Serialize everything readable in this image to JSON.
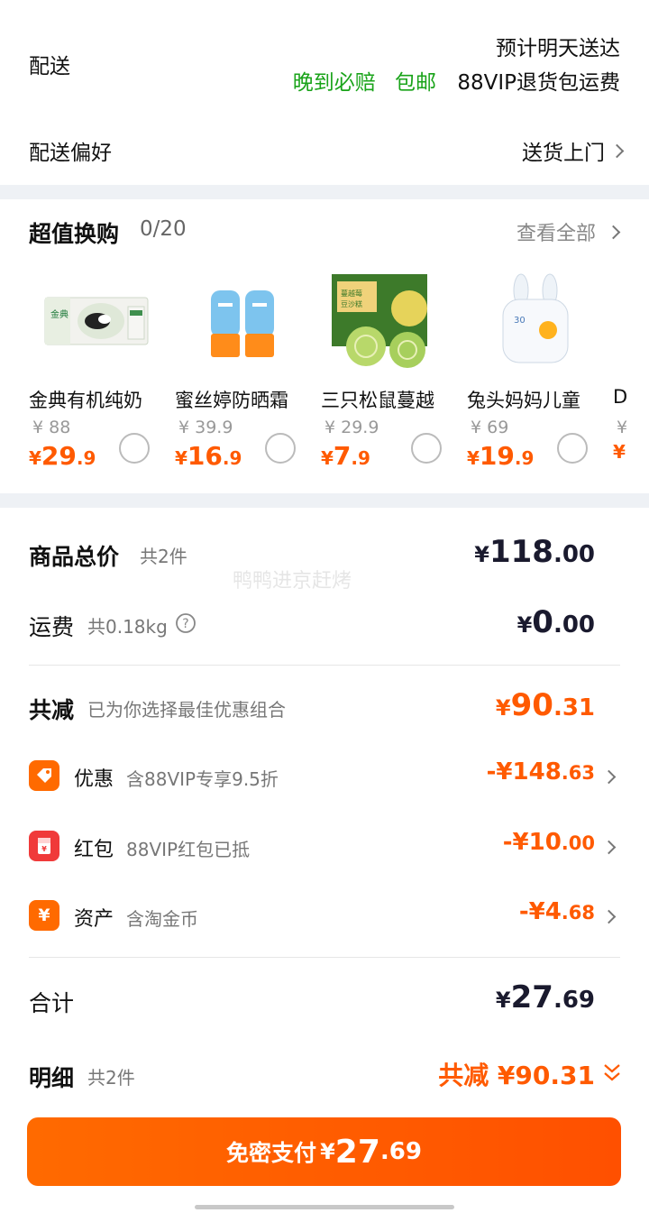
{
  "delivery": {
    "label": "配送",
    "eta": "预计明天送达",
    "tags": [
      "晚到必赔",
      "包邮",
      "88VIP退货包运费"
    ],
    "pref_label": "配送偏好",
    "pref_value": "送货上门"
  },
  "exchange": {
    "title": "超值换购",
    "count": "0/20",
    "view_all": "查看全部",
    "products": [
      {
        "name": "金典有机纯奶",
        "orig": "¥ 88",
        "price_int": "29",
        "price_dec": ".9"
      },
      {
        "name": "蜜丝婷防晒霜",
        "orig": "¥ 39.9",
        "price_int": "16",
        "price_dec": ".9"
      },
      {
        "name": "三只松鼠蔓越",
        "orig": "¥ 29.9",
        "price_int": "7",
        "price_dec": ".9"
      },
      {
        "name": "兔头妈妈儿童",
        "orig": "¥ 69",
        "price_int": "19",
        "price_dec": ".9"
      },
      {
        "name": "D",
        "orig": "¥",
        "price_int": "",
        "price_dec": ""
      }
    ],
    "currency": "¥"
  },
  "summary": {
    "goods_label": "商品总价",
    "goods_sub": "共2件",
    "goods_int": "118",
    "goods_dec": ".00",
    "freight_label": "运费",
    "freight_sub": "共0.18kg",
    "freight_int": "0",
    "freight_dec": ".00",
    "reduce_label": "共减",
    "reduce_sub": "已为你选择最佳优惠组合",
    "reduce_int": "90",
    "reduce_dec": ".31",
    "discounts": [
      {
        "label": "优惠",
        "sub": "含88VIP专享9.5折",
        "prefix": "-¥",
        "int": "148",
        "dec": ".63",
        "icon": "tag-icon",
        "color": "#ff6a00"
      },
      {
        "label": "红包",
        "sub": "88VIP红包已抵",
        "prefix": "-¥",
        "int": "10",
        "dec": ".00",
        "icon": "red-packet-icon",
        "color": "#f03a3a"
      },
      {
        "label": "资产",
        "sub": "含淘金币",
        "prefix": "-¥",
        "int": "4",
        "dec": ".68",
        "icon": "coin-icon",
        "color": "#ff6a00"
      }
    ],
    "total_label": "合计",
    "total_int": "27",
    "total_dec": ".69",
    "detail_label": "明细",
    "detail_sub": "共2件",
    "detail_reduce": "共减 ¥90.31"
  },
  "pay": {
    "label": "免密支付",
    "currency": "¥",
    "int": "27",
    "dec": ".69"
  },
  "watermark": "鸭鸭进京赶烤",
  "colors": {
    "accent": "#ff5a00",
    "green": "#19a319",
    "background_gap": "#eef1f5"
  }
}
